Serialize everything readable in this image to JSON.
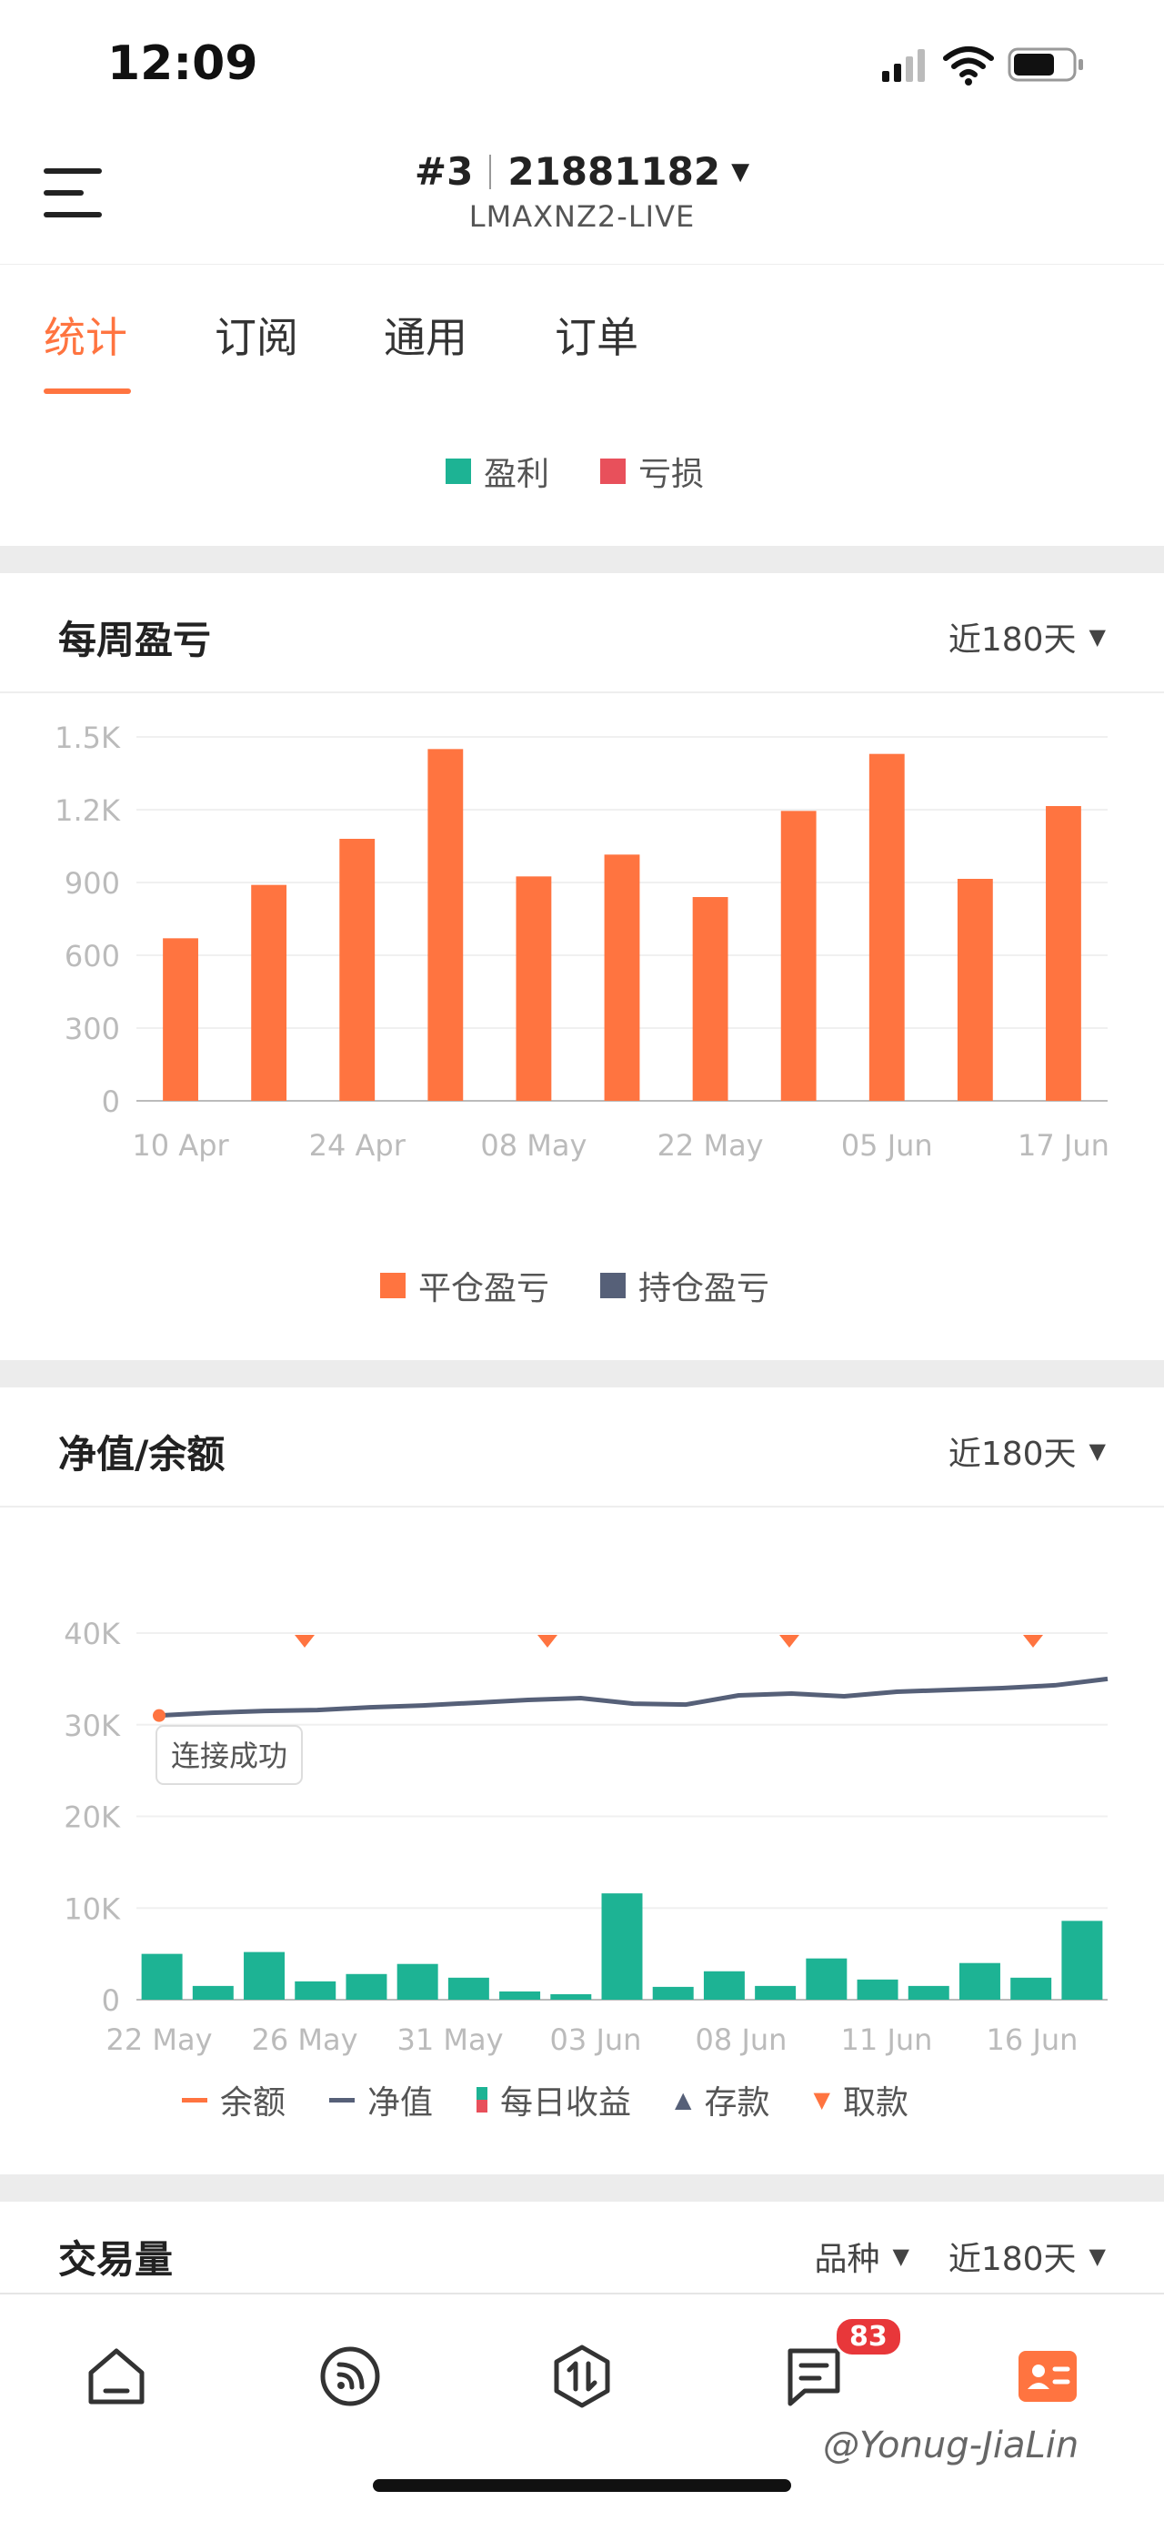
{
  "status": {
    "time": "12:09"
  },
  "header": {
    "account_number": "#3",
    "account_id": "21881182",
    "server": "LMAXNZ2-LIVE"
  },
  "tabs": [
    {
      "label": "统计"
    },
    {
      "label": "订阅"
    },
    {
      "label": "通用"
    },
    {
      "label": "订单"
    }
  ],
  "top_legend": {
    "profit": "盈利",
    "loss": "亏损"
  },
  "weekly": {
    "title": "每周盈亏",
    "range": "近180天",
    "legend": {
      "closed": "平仓盈亏",
      "open": "持仓盈亏"
    }
  },
  "equity": {
    "title": "净值/余额",
    "range": "近180天",
    "tooltip": "连接成功",
    "legend": {
      "balance": "余额",
      "equity": "净值",
      "daily": "每日收益",
      "deposit": "存款",
      "withdraw": "取款"
    }
  },
  "volume": {
    "title": "交易量",
    "filter": "品种",
    "range": "近180天"
  },
  "nav": {
    "badge": "83"
  },
  "watermark": "@Yonug-JiaLin",
  "colors": {
    "accent": "#ff7440",
    "bar": "#ff7440",
    "profit": "#1db394",
    "loss": "#e8505b",
    "line": "#566078"
  },
  "chart_data": [
    {
      "type": "bar",
      "ylim": [
        0,
        1500
      ],
      "yticks": [
        "0",
        "300",
        "600",
        "900",
        "1.2K",
        "1.5K"
      ],
      "xticks": [
        "10 Apr",
        "24 Apr",
        "08 May",
        "22 May",
        "05 Jun",
        "17 Jun"
      ],
      "series": [
        {
          "name": "平仓盈亏",
          "values": [
            670,
            890,
            1080,
            1450,
            925,
            1015,
            840,
            1195,
            1430,
            915,
            1215
          ]
        }
      ]
    },
    {
      "type": "bar",
      "ylim": [
        0,
        40000
      ],
      "yticks": [
        "0",
        "10K",
        "20K",
        "30K",
        "40K"
      ],
      "xticks": [
        "22 May",
        "26 May",
        "31 May",
        "03 Jun",
        "08 Jun",
        "11 Jun",
        "16 Jun"
      ],
      "series": [
        {
          "name": "每日收益",
          "values": [
            5000,
            1500,
            5200,
            2000,
            2800,
            3900,
            2400,
            900,
            600,
            11600,
            1400,
            3100,
            1500,
            4500,
            2200,
            1500,
            4000,
            2400,
            8600
          ]
        },
        {
          "name": "净值",
          "values": [
            31000,
            31300,
            31500,
            31600,
            31900,
            32100,
            32400,
            32700,
            32900,
            32300,
            32200,
            33200,
            33400,
            33100,
            33600,
            33800,
            34000,
            34300,
            35000
          ]
        }
      ]
    }
  ]
}
